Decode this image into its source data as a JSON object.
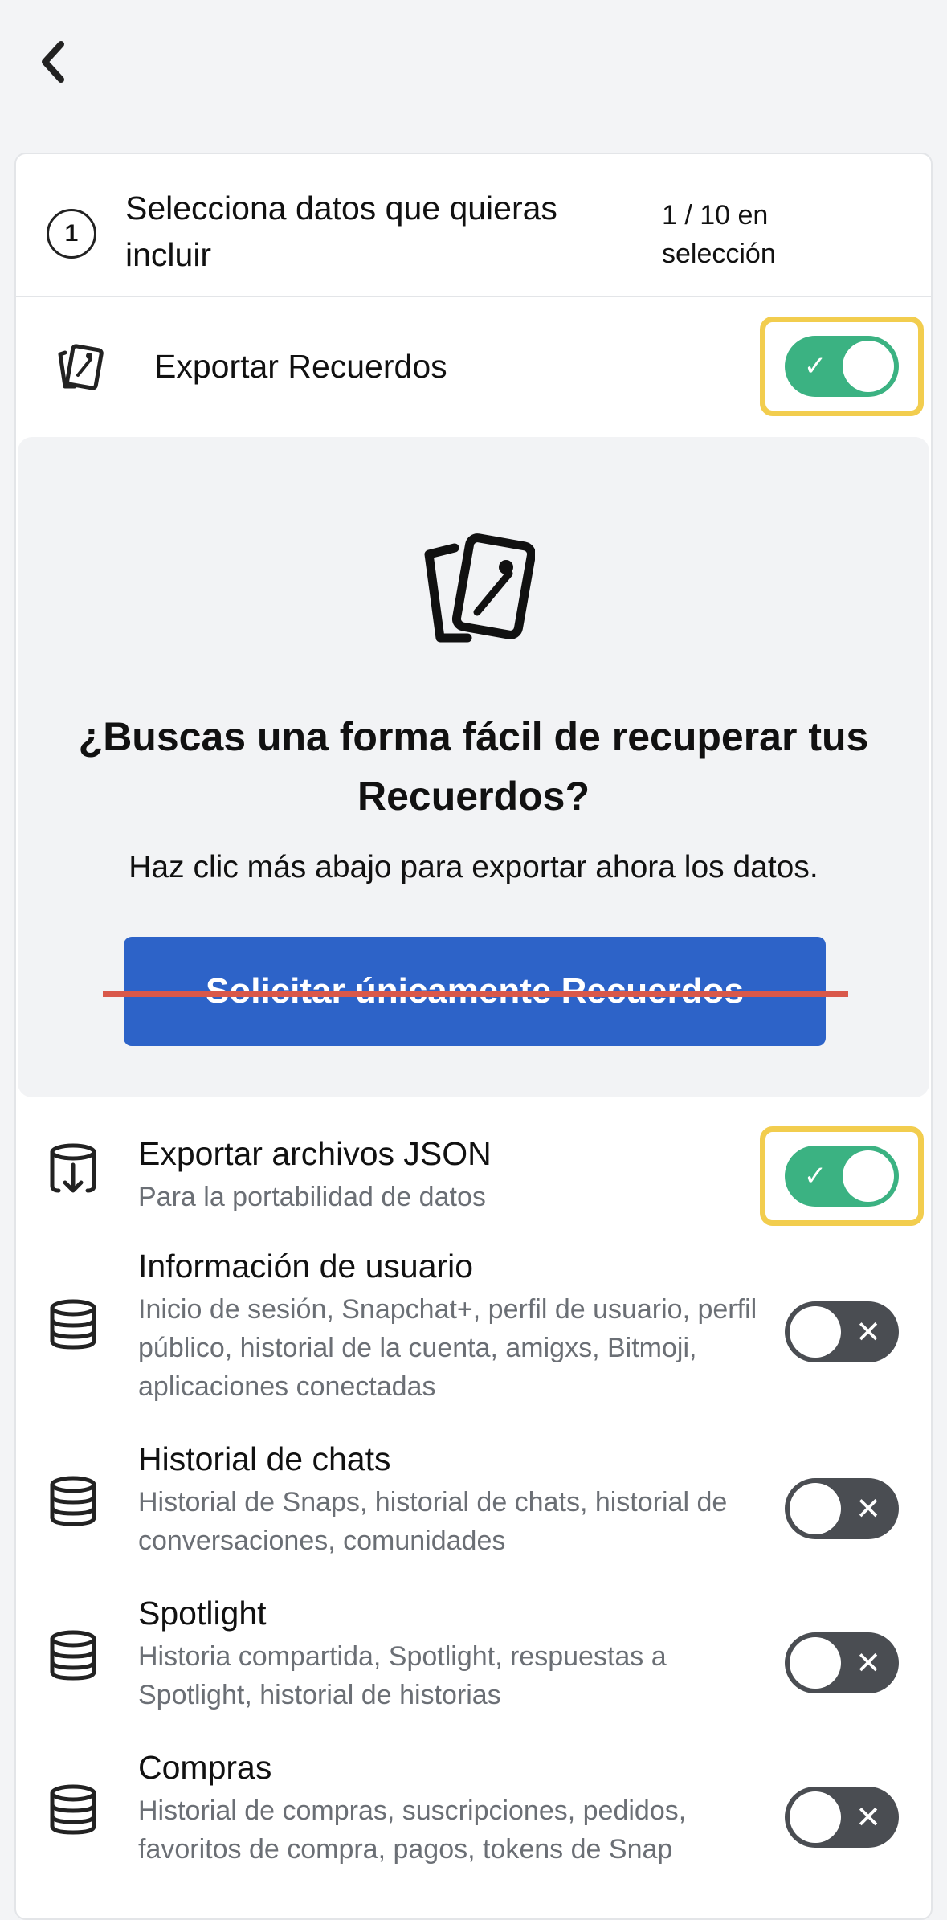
{
  "header": {
    "back_icon": "chevron-left-icon"
  },
  "step": {
    "number": "1",
    "title": "Selecciona datos que quieras incluir",
    "count": "1 / 10 en selección"
  },
  "export_memories": {
    "icon": "memories-icon",
    "label": "Exportar Recuerdos",
    "toggle_on": true
  },
  "promo": {
    "icon": "memories-icon",
    "title": "¿Buscas una forma fácil de recuperar tus Recuerdos?",
    "subtitle": "Haz clic más abajo para exportar ahora los datos.",
    "button_label": "Solicitar únicamente Recuerdos"
  },
  "options": [
    {
      "icon": "database-download-icon",
      "title": "Exportar archivos JSON",
      "subtitle": "Para la portabilidad de datos",
      "toggle_on": true
    },
    {
      "icon": "database-icon",
      "title": "Información de usuario",
      "subtitle": "Inicio de sesión, Snapchat+, perfil de usuario, perfil público, historial de la cuenta, amigxs, Bitmoji, aplicaciones conectadas",
      "toggle_on": false
    },
    {
      "icon": "database-icon",
      "title": "Historial de chats",
      "subtitle": "Historial de Snaps, historial de chats, historial de conversaciones, comunidades",
      "toggle_on": false
    },
    {
      "icon": "database-icon",
      "title": "Spotlight",
      "subtitle": "Historia compartida, Spotlight, respuestas a Spotlight, historial de historias",
      "toggle_on": false
    },
    {
      "icon": "database-icon",
      "title": "Compras",
      "subtitle": "Historial de compras, suscripciones, pedidos, favoritos de compra, pagos, tokens de Snap",
      "toggle_on": false
    }
  ],
  "colors": {
    "toggle_on": "#3bb282",
    "toggle_off": "#4a4d52",
    "highlight": "#f2cd4e",
    "button": "#2d63c8",
    "strike": "#d9584a"
  }
}
